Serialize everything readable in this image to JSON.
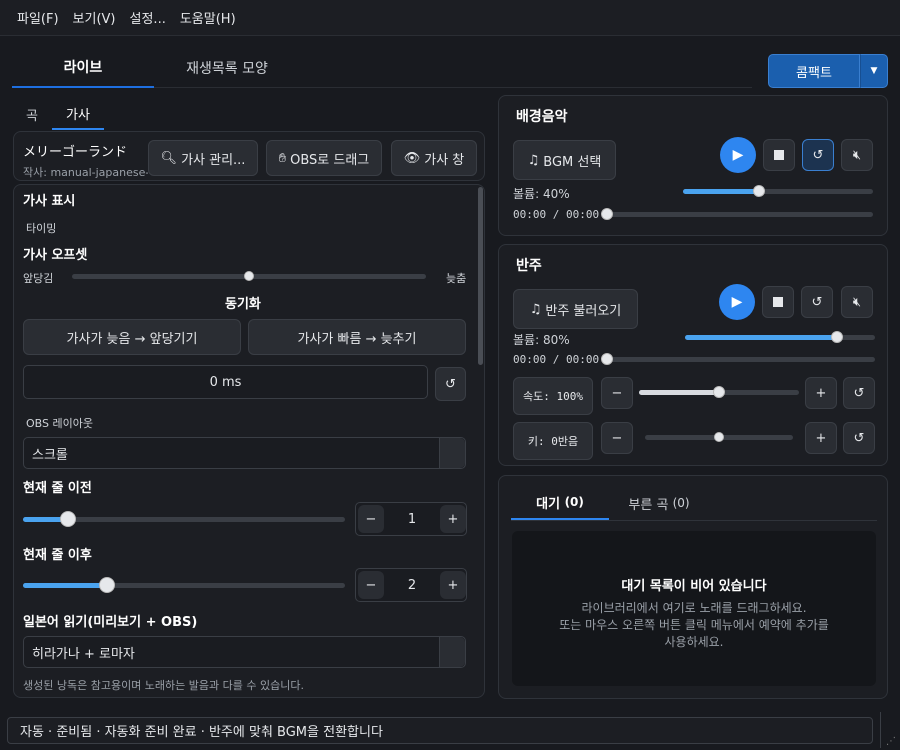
{
  "menu": {
    "file": "파일(F)",
    "view": "보기(V)",
    "settings": "설정...",
    "help": "도움말(H)"
  },
  "top_tabs": {
    "live": "라이브",
    "playlist": "재생목록 모양"
  },
  "compact_button": "콤팩트",
  "sub_tabs": {
    "song": "곡",
    "lyrics": "가사"
  },
  "song": {
    "title": "メリーゴーランド",
    "author": "작사: manual-japanese-"
  },
  "lyric_buttons": {
    "manage": "가사 관리...",
    "obs_drag": "OBS로 드래그",
    "window": "가사 창"
  },
  "lyrics_panel": {
    "title": "가사 표시",
    "timing": "타이밍",
    "offset_heading": "가사 오프셋",
    "earlier": "앞당김",
    "later": "늦춤",
    "offset_level": 0.5,
    "sync_heading": "동기화",
    "late_button": "가사가 늦음 → 앞당기기",
    "fast_button": "가사가 빠름 → 늦추기",
    "offset_value": "0 ms",
    "obs_layout": "OBS 레이아웃",
    "layout_value": "스크롤",
    "before_heading": "현재 줄 이전",
    "before_value": "1",
    "before_level": 0.14,
    "after_heading": "현재 줄 이후",
    "after_value": "2",
    "after_level": 0.26,
    "reading_heading": "일본어 읽기(미리보기 + OBS)",
    "reading_value": "히라가나 + 로마자",
    "note": "생성된 낭독은 참고용이며 노래하는 발음과 다를 수 있습니다."
  },
  "bgm": {
    "title": "배경음악",
    "select": "BGM 선택",
    "volume": "볼륨: 40%",
    "volume_level": 0.4,
    "time": "00:00 / 00:00"
  },
  "accomp": {
    "title": "반주",
    "load": "반주 불러오기",
    "volume": "볼륨: 80%",
    "volume_level": 0.8,
    "time": "00:00 / 00:00",
    "speed": "속도: 100%",
    "speed_level": 0.5,
    "key": "키: 0반음",
    "key_level": 0.5
  },
  "queue": {
    "tab_queue": "대기",
    "queue_count": "(0)",
    "tab_sung": "부른 곡",
    "sung_count": "(0)",
    "empty_title": "대기 목록이 비어 있습니다",
    "empty_line1": "라이브러리에서 여기로 노래를 드래그하세요.",
    "empty_line2": "또는 마우스 오른쪽 버튼 클릭 메뉴에서 예약에 추가를",
    "empty_line3": "사용하세요."
  },
  "status": "자동 · 준비됨 · 자동화 준비 완료 · 반주에 맞춰 BGM을 전환합니다",
  "colors": {
    "accent": "#2e86f0",
    "slider": "#4aa3ef",
    "background": "#181a1f"
  }
}
